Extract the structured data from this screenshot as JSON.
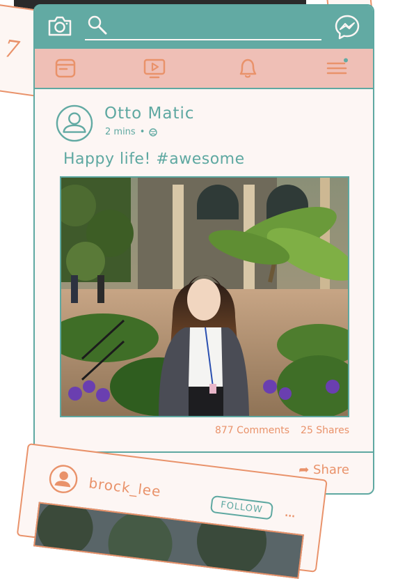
{
  "colors": {
    "teal": "#62aaa3",
    "pink": "#efbfb6",
    "orange": "#e9926a",
    "paper": "#fdf6f4"
  },
  "background": {
    "scribble": "7"
  },
  "topbar": {
    "camera_icon": "camera-icon",
    "search_icon": "search-icon",
    "messenger_icon": "messenger-icon"
  },
  "nav": {
    "items": [
      "feed-icon",
      "video-icon",
      "bell-icon",
      "menu-icon"
    ]
  },
  "post": {
    "author": "Otto Matic",
    "time": "2 mins",
    "caption": "Happy life! #awesome",
    "comments": "877 Comments",
    "shares": "25 Shares",
    "share_label": "Share"
  },
  "next_post": {
    "username": "brock_lee",
    "follow_label": "FOLLOW",
    "more": "..."
  }
}
